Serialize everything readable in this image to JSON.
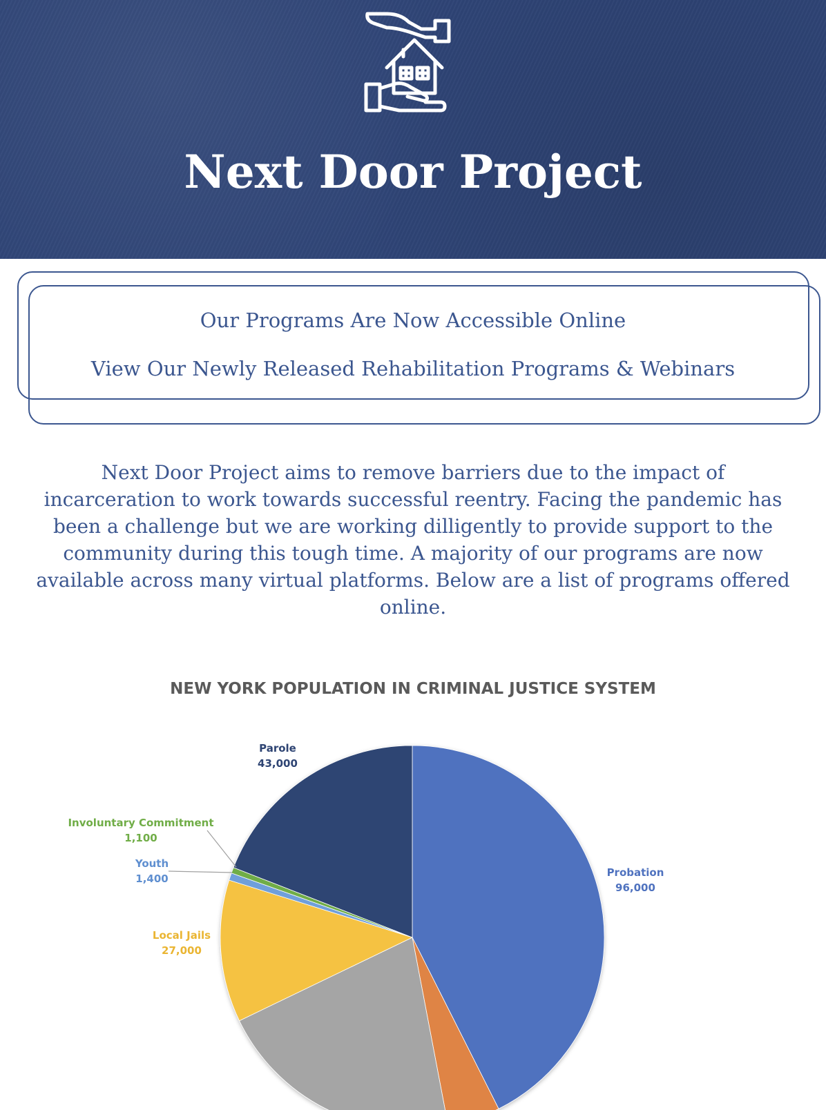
{
  "header": {
    "logo_icon": "hands-house-icon",
    "title": "Next Door Project",
    "background_color": "#2f4577"
  },
  "banner": {
    "line1": "Our Programs Are Now Accessible Online",
    "line2": "View Our Newly Released Rehabilitation Programs & Webinars",
    "border_color": "#3b568f"
  },
  "intro": {
    "text": "Next Door Project aims to remove barriers due to the impact of incarceration to work towards successful reentry. Facing the pandemic has been a challenge but we are working dilligently to provide support to the community during this tough time. A majority of our programs are now available across many virtual platforms. Below are a list of programs offered online."
  },
  "chart_data": {
    "type": "pie",
    "title": "NEW YORK POPULATION IN CRIMINAL JUSTICE SYSTEM",
    "start": "top, clockwise",
    "slices": [
      {
        "label": "Probation",
        "value": 96000,
        "value_text": "96,000",
        "color": "#4f72bf",
        "label_color": "#4f72bf"
      },
      {
        "label": "",
        "value": 10000,
        "value_text": "",
        "color": "#df8445",
        "label_color": "#df8445"
      },
      {
        "label": "",
        "value": 47000,
        "value_text": "",
        "color": "#a5a5a5",
        "label_color": "#a5a5a5"
      },
      {
        "label": "Local Jails",
        "value": 27000,
        "value_text": "27,000",
        "color": "#f5c242",
        "label_color": "#eab532"
      },
      {
        "label": "Youth",
        "value": 1400,
        "value_text": "1,400",
        "color": "#6f9fda",
        "label_color": "#5f8fd0"
      },
      {
        "label": "Involuntary Commitment",
        "value": 1100,
        "value_text": "1,100",
        "color": "#70ad47",
        "label_color": "#70ad47"
      },
      {
        "label": "Parole",
        "value": 43000,
        "value_text": "43,000",
        "color": "#2e4473",
        "label_color": "#2e4473"
      }
    ]
  }
}
